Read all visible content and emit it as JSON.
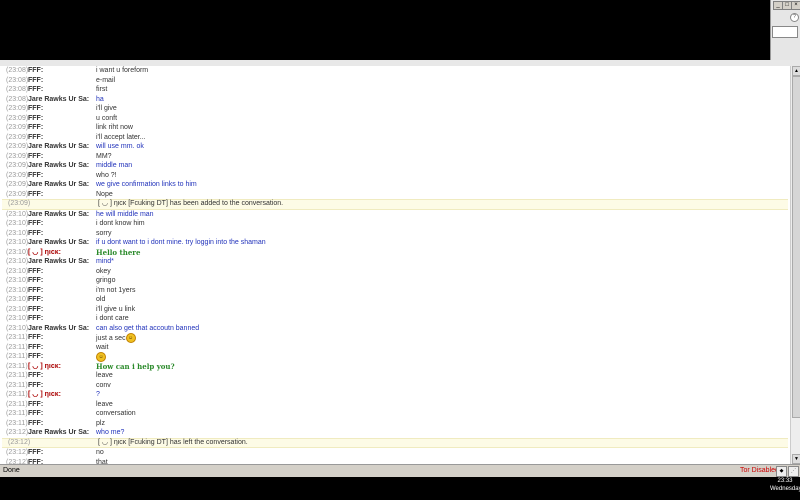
{
  "top": {
    "help_glyph": "?",
    "window_buttons": [
      "_",
      "□",
      "×"
    ]
  },
  "messages": [
    {
      "ts": "(23:08)",
      "nick": "FFF:",
      "text": "i want u foreform",
      "kind": "self"
    },
    {
      "ts": "(23:08)",
      "nick": "FFF:",
      "text": "e-mail",
      "kind": "self"
    },
    {
      "ts": "(23:08)",
      "nick": "FFF:",
      "text": "first",
      "kind": "self"
    },
    {
      "ts": "(23:08)",
      "nick": "Jare Rawks Ur Sa:",
      "text": "ha",
      "kind": "other"
    },
    {
      "ts": "(23:09)",
      "nick": "FFF:",
      "text": "i'll give",
      "kind": "self"
    },
    {
      "ts": "(23:09)",
      "nick": "FFF:",
      "text": "u conft",
      "kind": "self"
    },
    {
      "ts": "(23:09)",
      "nick": "FFF:",
      "text": "link riht now",
      "kind": "self"
    },
    {
      "ts": "(23:09)",
      "nick": "FFF:",
      "text": "i'll accept later...",
      "kind": "self"
    },
    {
      "ts": "(23:09)",
      "nick": "Jare Rawks Ur Sa:",
      "text": "will use mm. ok",
      "kind": "other"
    },
    {
      "ts": "(23:09)",
      "nick": "FFF:",
      "text": "MM?",
      "kind": "self"
    },
    {
      "ts": "(23:09)",
      "nick": "Jare Rawks Ur Sa:",
      "text": "middle man",
      "kind": "other"
    },
    {
      "ts": "(23:09)",
      "nick": "FFF:",
      "text": "who ?!",
      "kind": "self"
    },
    {
      "ts": "(23:09)",
      "nick": "Jare Rawks Ur Sa:",
      "text": "we give confirmation links to him",
      "kind": "other"
    },
    {
      "ts": "(23:09)",
      "nick": "FFF:",
      "text": "Nope",
      "kind": "self"
    },
    {
      "ts": "(23:09)",
      "nick": "",
      "text": "[ ◡ ] ηιcκ [Fcuking DT] has been added to the conversation.",
      "kind": "sys"
    },
    {
      "ts": "(23:10)",
      "nick": "Jare Rawks Ur Sa:",
      "text": "he will middle man",
      "kind": "other"
    },
    {
      "ts": "(23:10)",
      "nick": "FFF:",
      "text": "i dont know him",
      "kind": "self"
    },
    {
      "ts": "(23:10)",
      "nick": "FFF:",
      "text": "sorry",
      "kind": "self"
    },
    {
      "ts": "(23:10)",
      "nick": "Jare Rawks Ur Sa:",
      "text": "if u dont want to i dont mine. try loggin into the shaman",
      "kind": "other"
    },
    {
      "ts": "(23:10)",
      "nick": "[ ◡ ] ηιcκ:",
      "text": "Hello there",
      "kind": "nick"
    },
    {
      "ts": "(23:10)",
      "nick": "Jare Rawks Ur Sa:",
      "text": "mind*",
      "kind": "other"
    },
    {
      "ts": "(23:10)",
      "nick": "FFF:",
      "text": "okey",
      "kind": "self"
    },
    {
      "ts": "(23:10)",
      "nick": "FFF:",
      "text": "gringo",
      "kind": "self"
    },
    {
      "ts": "(23:10)",
      "nick": "FFF:",
      "text": "i'm not 1yers",
      "kind": "self"
    },
    {
      "ts": "(23:10)",
      "nick": "FFF:",
      "text": "old",
      "kind": "self"
    },
    {
      "ts": "(23:10)",
      "nick": "FFF:",
      "text": "i'll give u link",
      "kind": "self"
    },
    {
      "ts": "(23:10)",
      "nick": "FFF:",
      "text": "i dont care",
      "kind": "self"
    },
    {
      "ts": "(23:10)",
      "nick": "Jare Rawks Ur Sa:",
      "text": "can also get that accoutn banned",
      "kind": "other"
    },
    {
      "ts": "(23:11)",
      "nick": "FFF:",
      "text": "just a sec",
      "kind": "self",
      "smiley": true
    },
    {
      "ts": "(23:11)",
      "nick": "FFF:",
      "text": "wait",
      "kind": "self"
    },
    {
      "ts": "(23:11)",
      "nick": "FFF:",
      "text": "",
      "kind": "self",
      "smiley": true
    },
    {
      "ts": "(23:11)",
      "nick": "[ ◡ ] ηιcκ:",
      "text": "How can i help you?",
      "kind": "nick"
    },
    {
      "ts": "(23:11)",
      "nick": "FFF:",
      "text": "leave",
      "kind": "self"
    },
    {
      "ts": "(23:11)",
      "nick": "FFF:",
      "text": "conv",
      "kind": "self"
    },
    {
      "ts": "(23:11)",
      "nick": "[ ◡ ] ηιcκ:",
      "text": "?",
      "kind": "nickplain"
    },
    {
      "ts": "(23:11)",
      "nick": "FFF:",
      "text": "leave",
      "kind": "self"
    },
    {
      "ts": "(23:11)",
      "nick": "FFF:",
      "text": "conversation",
      "kind": "self"
    },
    {
      "ts": "(23:11)",
      "nick": "FFF:",
      "text": "plz",
      "kind": "self"
    },
    {
      "ts": "(23:12)",
      "nick": "Jare Rawks Ur Sa:",
      "text": "who me?",
      "kind": "other"
    },
    {
      "ts": "(23:12)",
      "nick": "",
      "text": "[ ◡ ] ηιcκ [Fcuking DT] has left the conversation.",
      "kind": "sys"
    },
    {
      "ts": "(23:12)",
      "nick": "FFF:",
      "text": "no",
      "kind": "self"
    },
    {
      "ts": "(23:12)",
      "nick": "FFF:",
      "text": "that",
      "kind": "self"
    }
  ],
  "status": {
    "left": "Done",
    "tor": "Tor Disabled"
  },
  "clock": {
    "time": "23:33",
    "day": "Wednesday"
  }
}
